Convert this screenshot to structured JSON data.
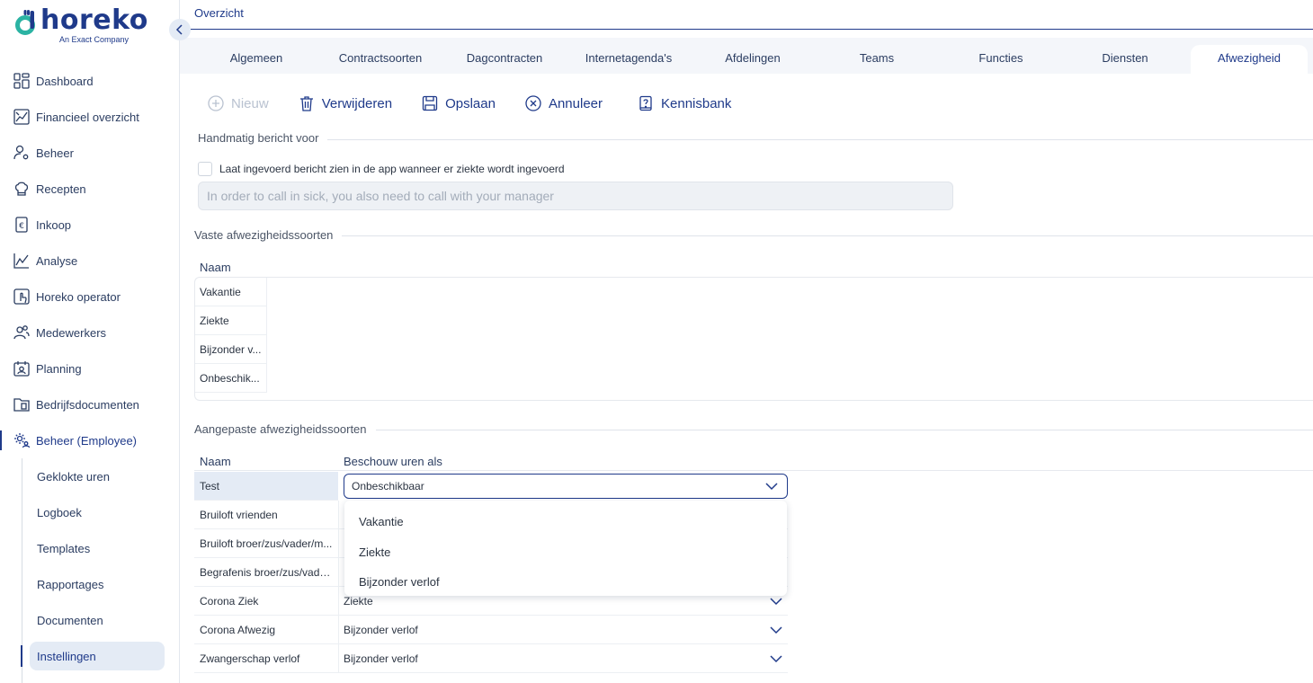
{
  "brand": {
    "name": "horeko",
    "tagline": "An Exact Company",
    "color": "#1f3a8a",
    "accent": "#2bb3a3"
  },
  "sidebar": {
    "items": [
      {
        "label": "Dashboard",
        "icon": "dashboard-icon"
      },
      {
        "label": "Financieel overzicht",
        "icon": "finance-chart-icon"
      },
      {
        "label": "Beheer",
        "icon": "user-gear-icon"
      },
      {
        "label": "Recepten",
        "icon": "chef-hat-icon"
      },
      {
        "label": "Inkoop",
        "icon": "euro-receipt-icon"
      },
      {
        "label": "Analyse",
        "icon": "analytics-icon"
      },
      {
        "label": "Horeko operator",
        "icon": "operator-touch-icon"
      },
      {
        "label": "Medewerkers",
        "icon": "employees-icon"
      },
      {
        "label": "Planning",
        "icon": "calendar-person-icon"
      },
      {
        "label": "Bedrijfsdocumenten",
        "icon": "documents-folder-icon"
      },
      {
        "label": "Beheer (Employee)",
        "icon": "settings-people-icon"
      }
    ],
    "sub_items": [
      {
        "label": "Geklokte uren"
      },
      {
        "label": "Logboek"
      },
      {
        "label": "Templates"
      },
      {
        "label": "Rapportages"
      },
      {
        "label": "Documenten"
      },
      {
        "label": "Instellingen"
      }
    ]
  },
  "header": {
    "breadcrumb": "Overzicht"
  },
  "tabs": [
    {
      "label": "Algemeen"
    },
    {
      "label": "Contractsoorten"
    },
    {
      "label": "Dagcontracten"
    },
    {
      "label": "Internetagenda's"
    },
    {
      "label": "Afdelingen"
    },
    {
      "label": "Teams"
    },
    {
      "label": "Functies"
    },
    {
      "label": "Diensten"
    },
    {
      "label": "Afwezigheid"
    }
  ],
  "active_tab": "Afwezigheid",
  "toolbar": {
    "new_label": "Nieuw",
    "delete_label": "Verwijderen",
    "save_label": "Opslaan",
    "cancel_label": "Annuleer",
    "knowledge_label": "Kennisbank"
  },
  "manual_message": {
    "section_title": "Handmatig bericht voor",
    "checkbox_label": "Laat ingevoerd bericht zien in de app wanneer er ziekte wordt ingevoerd",
    "checked": false,
    "message_placeholder": "In order to call in sick, you also need to call with your manager"
  },
  "fixed_types": {
    "section_title": "Vaste afwezigheidssoorten",
    "column_name": "Naam",
    "rows": [
      "Vakantie",
      "Ziekte",
      "Bijzonder v...",
      "Onbeschik..."
    ]
  },
  "custom_types": {
    "section_title": "Aangepaste afwezigheidssoorten",
    "column_name": "Naam",
    "column_hours": "Beschouw uren als",
    "rows": [
      {
        "name": "Test",
        "value": "Onbeschikbaar"
      },
      {
        "name": "Bruiloft vrienden",
        "value": ""
      },
      {
        "name": "Bruiloft broer/zus/vader/m...",
        "value": ""
      },
      {
        "name": "Begrafenis broer/zus/vade...",
        "value": ""
      },
      {
        "name": "Corona Ziek",
        "value": "Ziekte"
      },
      {
        "name": "Corona Afwezig",
        "value": "Bijzonder verlof"
      },
      {
        "name": "Zwangerschap verlof",
        "value": "Bijzonder verlof"
      }
    ],
    "dropdown_options": [
      "Vakantie",
      "Ziekte",
      "Bijzonder verlof"
    ]
  }
}
